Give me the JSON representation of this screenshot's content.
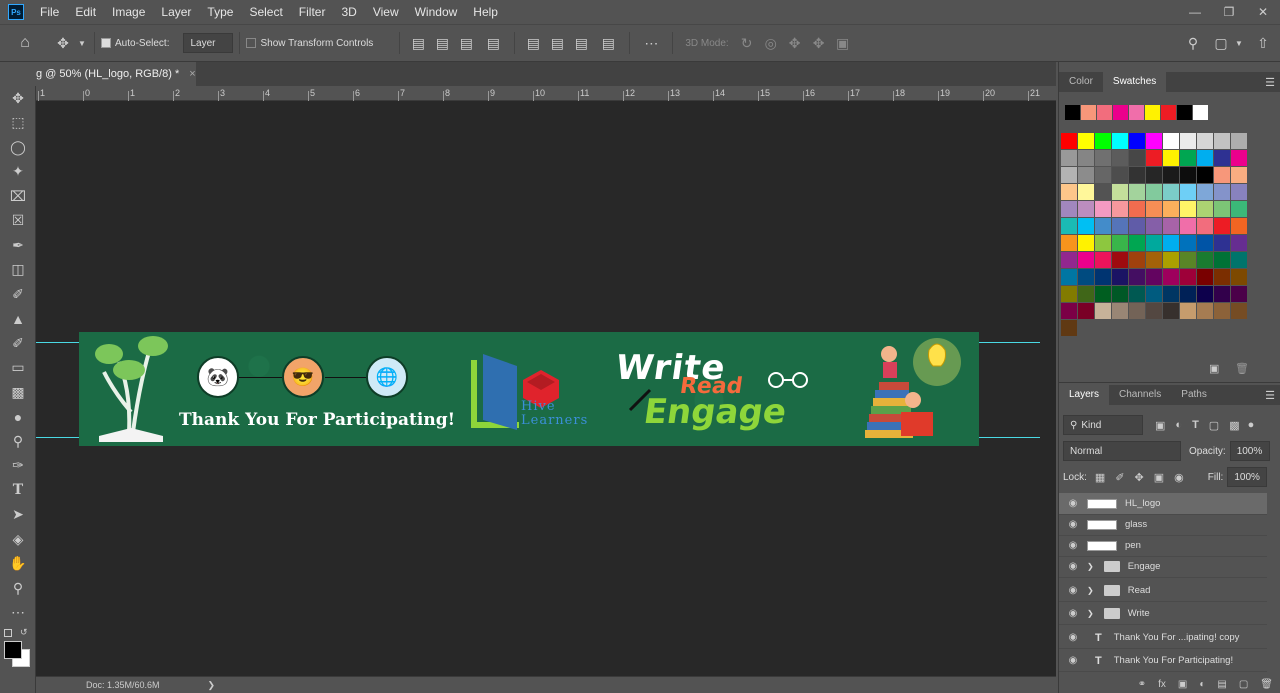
{
  "menu": {
    "logo": "Ps",
    "items": [
      "File",
      "Edit",
      "Image",
      "Layer",
      "Type",
      "Select",
      "Filter",
      "3D",
      "View",
      "Window",
      "Help"
    ]
  },
  "options": {
    "auto_select_label": "Auto-Select:",
    "auto_select_target": "Layer",
    "transform_label": "Show Transform Controls",
    "mode_3d_label": "3D Mode:"
  },
  "document": {
    "tab_title": "g @ 50% (HL_logo, RGB/8) *",
    "close": "×",
    "status": "Doc: 1.35M/60.6M"
  },
  "ruler_labels": [
    "1",
    "0",
    "1",
    "2",
    "3",
    "4",
    "5",
    "6",
    "7",
    "8",
    "9",
    "10",
    "11",
    "12",
    "13",
    "14",
    "15",
    "16",
    "17",
    "18",
    "19",
    "20",
    "21"
  ],
  "banner": {
    "thank_you": "Thank You For Participating!",
    "hl_line1": "Hive",
    "hl_line2": "Learners",
    "write": "Write",
    "read": "Read",
    "engage": "Engage"
  },
  "color_panel": {
    "tabs": [
      "Color",
      "Swatches"
    ],
    "active": "Swatches",
    "recent": [
      "#000000",
      "#f7977a",
      "#f26d7d",
      "#ec008c",
      "#f06eaa",
      "#fff200",
      "#ed1c24",
      "#000000",
      "#ffffff"
    ]
  },
  "layers_panel": {
    "tabs": [
      "Layers",
      "Channels",
      "Paths"
    ],
    "kind_filter": "Kind",
    "blend_mode": "Normal",
    "opacity_label": "Opacity:",
    "opacity_value": "100%",
    "lock_label": "Lock:",
    "fill_label": "Fill:",
    "fill_value": "100%",
    "layers": [
      {
        "name": "HL_logo",
        "type": "image",
        "selected": true
      },
      {
        "name": "glass",
        "type": "image"
      },
      {
        "name": "pen",
        "type": "image"
      },
      {
        "name": "Engage",
        "type": "group"
      },
      {
        "name": "Read",
        "type": "group"
      },
      {
        "name": "Write",
        "type": "group"
      },
      {
        "name": "Thank You For ...ipating! copy",
        "type": "text"
      },
      {
        "name": "Thank You For Participating!",
        "type": "text"
      }
    ]
  }
}
